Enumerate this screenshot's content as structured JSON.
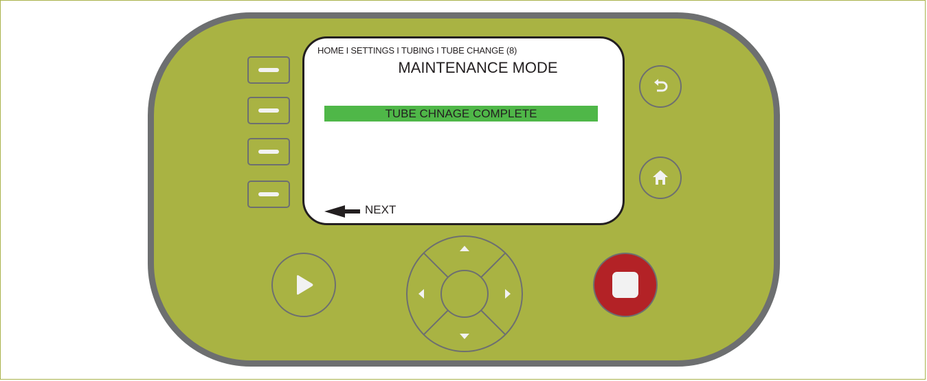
{
  "screen": {
    "breadcrumb": "HOME I SETTINGS I TUBING I TUBE CHANGE (8)",
    "title": "MAINTENANCE MODE",
    "selected_item": "TUBE CHNAGE COMPLETE",
    "next_label": "NEXT"
  },
  "icons": {
    "back": "undo-arrow-icon",
    "home": "house-icon",
    "play": "play-triangle-icon",
    "stop": "stop-square-icon",
    "up": "triangle-up-icon",
    "down": "triangle-down-icon",
    "left": "triangle-left-icon",
    "right": "triangle-right-icon",
    "next": "arrow-left-icon"
  },
  "colors": {
    "panel": "#a9b343",
    "bezel": "#6d6f70",
    "highlight": "#4fb748",
    "stop": "#b32226"
  }
}
